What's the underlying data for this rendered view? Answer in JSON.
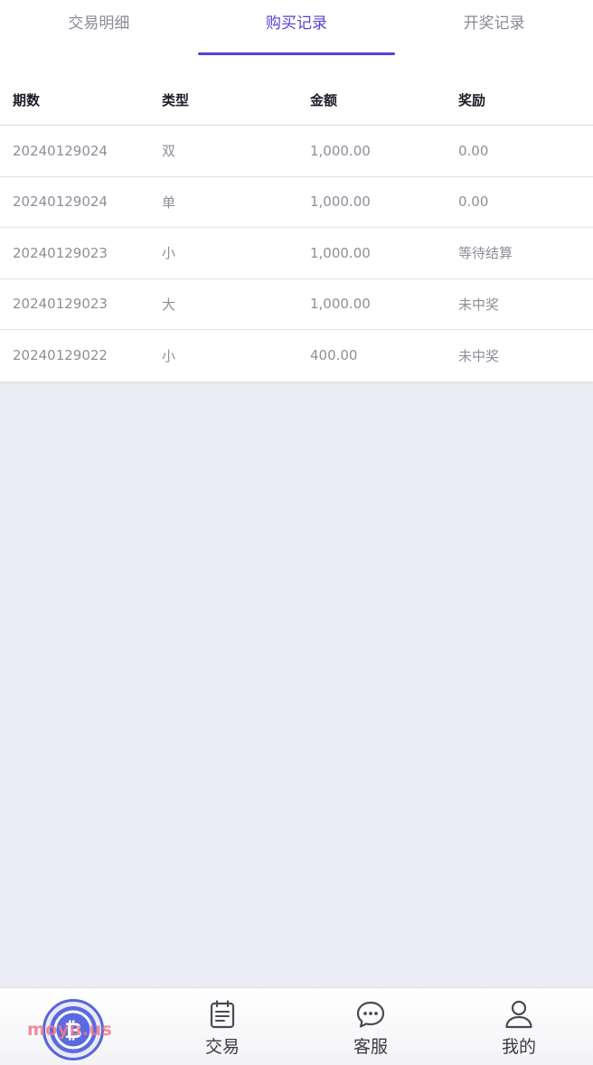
{
  "tabs": [
    {
      "label": "交易明细",
      "active": false
    },
    {
      "label": "购买记录",
      "active": true
    },
    {
      "label": "开奖记录",
      "active": false
    }
  ],
  "table": {
    "headers": [
      "期数",
      "类型",
      "金额",
      "奖励"
    ],
    "rows": [
      [
        "20240129024",
        "双",
        "1,000.00",
        "0.00"
      ],
      [
        "20240129024",
        "单",
        "1,000.00",
        "0.00"
      ],
      [
        "20240129023",
        "小",
        "1,000.00",
        "等待结算"
      ],
      [
        "20240129023",
        "大",
        "1,000.00",
        "未中奖"
      ],
      [
        "20240129022",
        "小",
        "400.00",
        "未中奖"
      ]
    ]
  },
  "nav": {
    "home_icon": "bitcoin-icon",
    "items": [
      {
        "label": "交易",
        "icon": "document-icon"
      },
      {
        "label": "客服",
        "icon": "chat-bubble-icon"
      },
      {
        "label": "我的",
        "icon": "user-icon"
      }
    ]
  },
  "watermark": "moyu.us",
  "colors": {
    "accent": "#5b3fd6",
    "background": "#ECECF4",
    "home_ring": "#5666d8"
  }
}
